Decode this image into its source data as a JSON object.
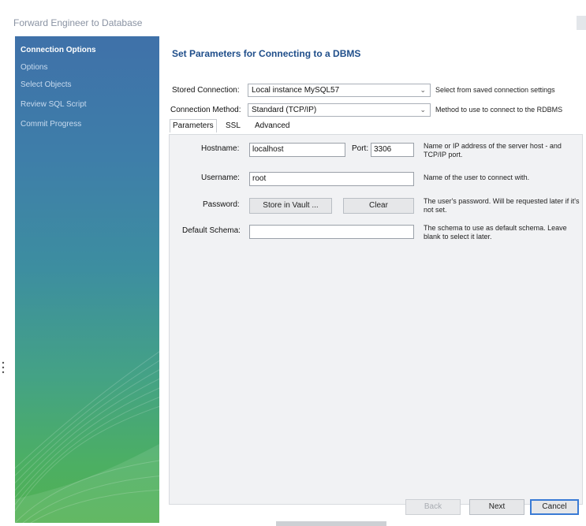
{
  "window": {
    "title": "Forward Engineer to Database"
  },
  "sidebar": {
    "items": [
      {
        "label": "Connection Options",
        "active": true
      },
      {
        "label": "Options",
        "active": false
      },
      {
        "label": "Select Objects",
        "active": false
      },
      {
        "label": "Review SQL Script",
        "active": false
      },
      {
        "label": "Commit Progress",
        "active": false
      }
    ]
  },
  "main": {
    "heading": "Set Parameters for Connecting to a DBMS",
    "stored_connection": {
      "label": "Stored Connection:",
      "value": "Local instance MySQL57",
      "hint": "Select from saved connection settings"
    },
    "connection_method": {
      "label": "Connection Method:",
      "value": "Standard (TCP/IP)",
      "hint": "Method to use to connect to the RDBMS"
    },
    "tabs": [
      {
        "label": "Parameters",
        "selected": true
      },
      {
        "label": "SSL",
        "selected": false
      },
      {
        "label": "Advanced",
        "selected": false
      }
    ],
    "hostname": {
      "label": "Hostname:",
      "value": "localhost",
      "hint": "Name or IP address of the server host - and TCP/IP port."
    },
    "port": {
      "label": "Port:",
      "value": "3306"
    },
    "username": {
      "label": "Username:",
      "value": "root",
      "hint": "Name of the user to connect with."
    },
    "password": {
      "label": "Password:",
      "store_button": "Store in Vault ...",
      "clear_button": "Clear",
      "hint": "The user's password. Will be requested later if it's not set."
    },
    "default_schema": {
      "label": "Default Schema:",
      "value": "",
      "hint": "The schema to use as default schema. Leave blank to select it later."
    }
  },
  "footer": {
    "back_button": "Back",
    "next_button": "Next",
    "cancel_button": "Cancel"
  },
  "colors": {
    "accent": "#1f4e8a",
    "sidebar_top": "#3f71a9",
    "sidebar_bottom": "#52b052"
  }
}
